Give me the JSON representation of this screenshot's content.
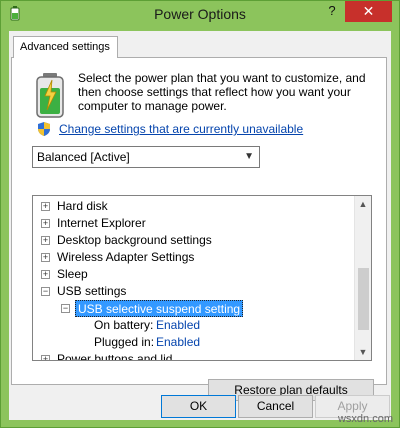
{
  "window": {
    "title": "Power Options",
    "help_label": "?",
    "close_label": "✕"
  },
  "tab": {
    "label": "Advanced settings"
  },
  "intro": {
    "text": "Select the power plan that you want to customize, and then choose settings that reflect how you want your computer to manage power."
  },
  "change_link": {
    "label": "Change settings that are currently unavailable"
  },
  "plan_select": {
    "value": "Balanced [Active]"
  },
  "tree": {
    "items": [
      {
        "label": "Hard disk",
        "expander": "+"
      },
      {
        "label": "Internet Explorer",
        "expander": "+"
      },
      {
        "label": "Desktop background settings",
        "expander": "+"
      },
      {
        "label": "Wireless Adapter Settings",
        "expander": "+"
      },
      {
        "label": "Sleep",
        "expander": "+"
      },
      {
        "label": "USB settings",
        "expander": "−"
      },
      {
        "label": "USB selective suspend setting",
        "expander": "−"
      },
      {
        "label": "On battery:",
        "value": "Enabled"
      },
      {
        "label": "Plugged in:",
        "value": "Enabled"
      },
      {
        "label": "Power buttons and lid",
        "expander": "+"
      }
    ]
  },
  "buttons": {
    "restore": "Restore plan defaults",
    "ok": "OK",
    "cancel": "Cancel",
    "apply": "Apply"
  },
  "watermark": "wsxdn.com",
  "colors": {
    "titlebar": "#8cc45c",
    "close": "#c7302b",
    "selection": "#3399ff",
    "link": "#0645ad"
  }
}
